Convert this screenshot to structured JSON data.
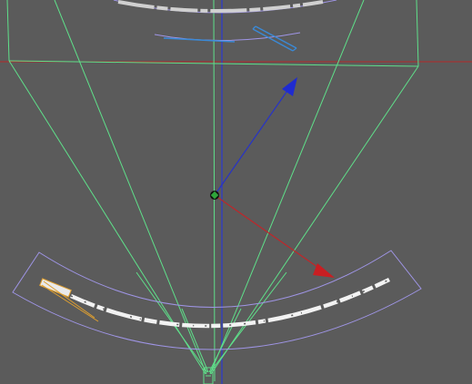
{
  "viewport": {
    "background_color": "#5b5b5b",
    "frustum_color": "#5fe08a",
    "arc_outline_color": "#9f95e6",
    "axis_x_color": "#c0262a",
    "axis_y_color": "#2e3ad6",
    "selection_color": "#e0a030",
    "highlight_color": "#3a8ad8"
  },
  "objects": {
    "top_arc": {
      "label": "curved-text-strip-top"
    },
    "bottom_arc": {
      "label": "curved-text-strip-bottom"
    },
    "camera_frustum": {
      "label": "camera-frustum"
    },
    "pivot": {
      "label": "object-pivot"
    }
  }
}
